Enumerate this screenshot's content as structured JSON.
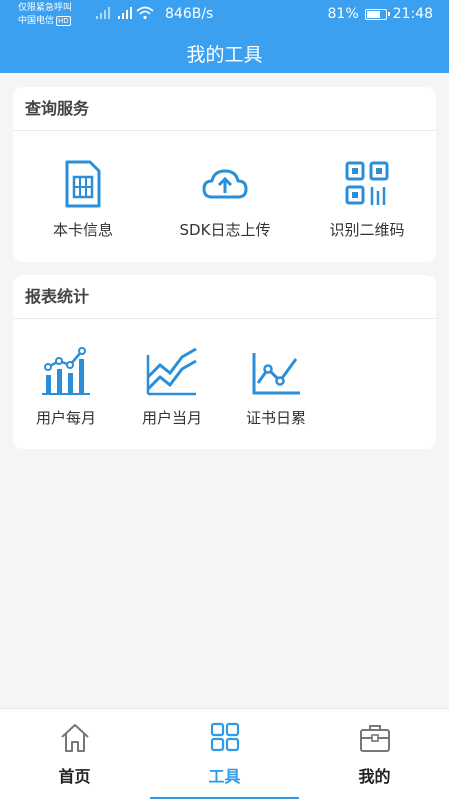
{
  "status_bar": {
    "carrier_line1": "仅限紧急呼叫",
    "carrier_line2": "中国电信",
    "hd_badge": "HD",
    "network_speed": "846B/s",
    "battery_percent": "81%",
    "battery_level": 0.81,
    "time": "21:48"
  },
  "header": {
    "title": "我的工具"
  },
  "query_section": {
    "title": "查询服务",
    "items": [
      {
        "label": "本卡信息",
        "icon": "sim-card-icon"
      },
      {
        "label": "SDK日志上传",
        "icon": "cloud-upload-icon"
      },
      {
        "label": "识别二维码",
        "icon": "qr-code-icon"
      }
    ]
  },
  "stats_section": {
    "title": "报表统计",
    "items": [
      {
        "label": "用户每月",
        "icon": "bar-line-chart-icon"
      },
      {
        "label": "用户当月",
        "icon": "area-trend-icon"
      },
      {
        "label": "证书日累",
        "icon": "line-chart-icon"
      }
    ]
  },
  "bottom_nav": {
    "items": [
      {
        "label": "首页",
        "icon": "home-icon",
        "active": false
      },
      {
        "label": "工具",
        "icon": "grid-icon",
        "active": true
      },
      {
        "label": "我的",
        "icon": "briefcase-icon",
        "active": false
      }
    ]
  },
  "colors": {
    "primary": "#3aa0ef",
    "accent": "#2f9be8",
    "icon_blue": "#2a8fd8"
  }
}
